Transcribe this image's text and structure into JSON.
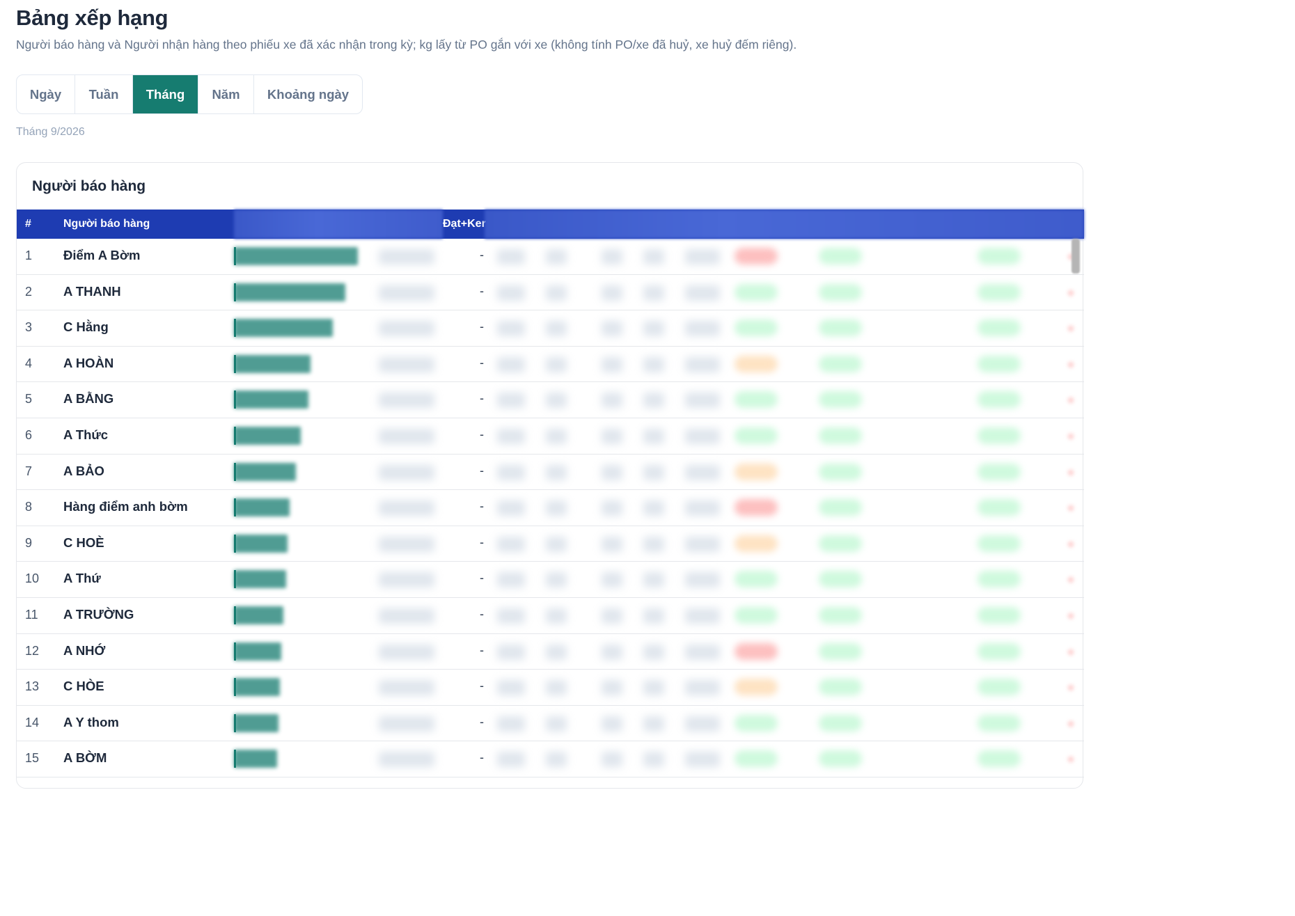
{
  "header": {
    "title": "Bảng xếp hạng",
    "subtitle": "Người báo hàng và Người nhận hàng theo phiếu xe đã xác nhận trong kỳ; kg lấy từ PO gắn với xe (không tính PO/xe đã huỷ, xe huỷ đếm riêng)."
  },
  "period_tabs": [
    {
      "label": "Ngày",
      "active": false
    },
    {
      "label": "Tuần",
      "active": false
    },
    {
      "label": "Tháng",
      "active": true
    },
    {
      "label": "Năm",
      "active": false
    },
    {
      "label": "Khoảng ngày",
      "active": false
    }
  ],
  "period_label": "Tháng 9/2026",
  "reporters_card": {
    "title": "Người báo hàng",
    "columns": {
      "rank": "#",
      "name": "Người báo hàng",
      "partial": "Đạt+Ker"
    },
    "rows": [
      {
        "rank": "1",
        "name": "Điểm A Bờm",
        "dash": "-",
        "kg_share": 1.0,
        "status": "red"
      },
      {
        "rank": "2",
        "name": "A THANH",
        "dash": "-",
        "kg_share": 0.9,
        "status": "green"
      },
      {
        "rank": "3",
        "name": "C Hằng",
        "dash": "-",
        "kg_share": 0.8,
        "status": "green"
      },
      {
        "rank": "4",
        "name": "A HOÀN",
        "dash": "-",
        "kg_share": 0.62,
        "status": "orange"
      },
      {
        "rank": "5",
        "name": "A BẰNG",
        "dash": "-",
        "kg_share": 0.6,
        "status": "green"
      },
      {
        "rank": "6",
        "name": "A Thức",
        "dash": "-",
        "kg_share": 0.54,
        "status": "green"
      },
      {
        "rank": "7",
        "name": "A BẢO",
        "dash": "-",
        "kg_share": 0.5,
        "status": "orange"
      },
      {
        "rank": "8",
        "name": "Hàng điểm anh bờm",
        "dash": "-",
        "kg_share": 0.45,
        "status": "red"
      },
      {
        "rank": "9",
        "name": "C HOÈ",
        "dash": "-",
        "kg_share": 0.43,
        "status": "orange"
      },
      {
        "rank": "10",
        "name": "A Thứ",
        "dash": "-",
        "kg_share": 0.42,
        "status": "green"
      },
      {
        "rank": "11",
        "name": "A TRƯỜNG",
        "dash": "-",
        "kg_share": 0.4,
        "status": "green"
      },
      {
        "rank": "12",
        "name": "A NHỚ",
        "dash": "-",
        "kg_share": 0.38,
        "status": "red"
      },
      {
        "rank": "13",
        "name": "C HÒE",
        "dash": "-",
        "kg_share": 0.37,
        "status": "orange"
      },
      {
        "rank": "14",
        "name": "A Y thom",
        "dash": "-",
        "kg_share": 0.36,
        "status": "green"
      },
      {
        "rank": "15",
        "name": "A BỜM",
        "dash": "-",
        "kg_share": 0.35,
        "status": "green"
      }
    ]
  },
  "colors": {
    "accent": "#167c70",
    "table_header": "#1e3cb2"
  }
}
